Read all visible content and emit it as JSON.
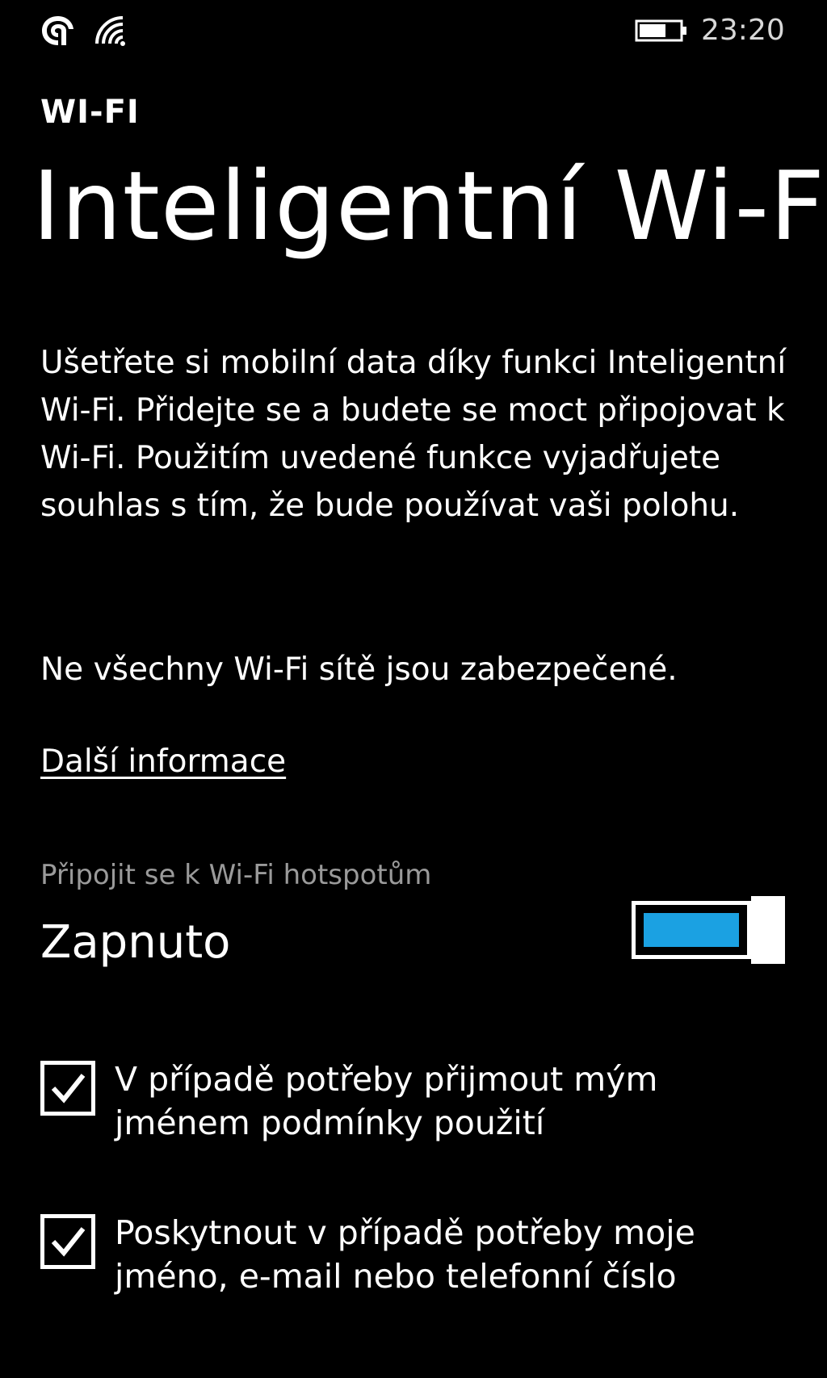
{
  "status_bar": {
    "time": "23:20",
    "icons": [
      "signal-icon",
      "wifi-icon",
      "battery-icon"
    ]
  },
  "header": {
    "app_title": "WI-FI",
    "page_title": "Inteligentní Wi-Fi"
  },
  "content": {
    "description": "Ušetřete si mobilní data díky funkci Inteligentní Wi-Fi. Přidejte se a budete se moct připojovat k Wi-Fi. Použitím uvedené funkce vyjadřujete souhlas s tím, že bude používat vaši polohu.",
    "warning": "Ne všechny Wi-Fi sítě jsou zabezpečené.",
    "more_info_link": "Další informace"
  },
  "hotspot_toggle": {
    "header": "Připojit se k Wi-Fi hotspotům",
    "state_label": "Zapnuto",
    "is_on": true
  },
  "checkboxes": [
    {
      "label": "V případě potřeby přijmout mým jménem podmínky použití",
      "checked": true
    },
    {
      "label": "Poskytnout v případě potřeby moje jméno, e-mail nebo telefonní číslo",
      "checked": true
    }
  ],
  "colors": {
    "background": "#000000",
    "foreground": "#ffffff",
    "accent": "#1ba1e2",
    "subtle_text": "#9a9a9a"
  }
}
